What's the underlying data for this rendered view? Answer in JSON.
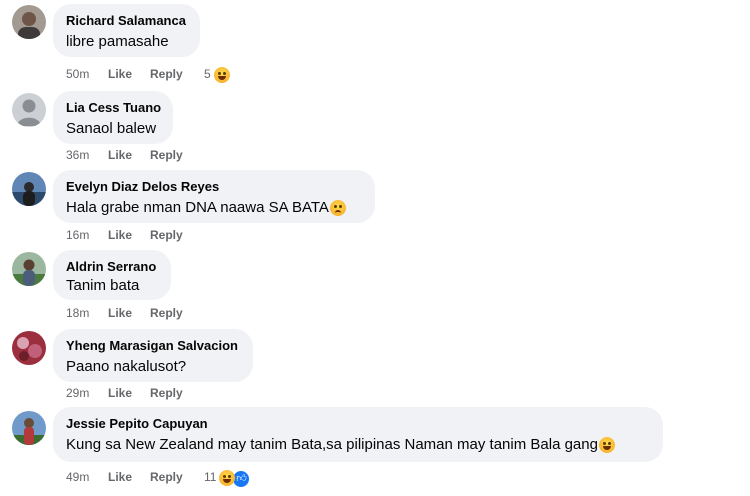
{
  "comments": [
    {
      "name": "Richard Salamanca",
      "text": "libre pamasahe",
      "time": "50m",
      "like": "Like",
      "reply": "Reply",
      "reaction_count": "5",
      "reaction_icon": "laughing-emoji-icon"
    },
    {
      "name": "Lia Cess Tuano",
      "text": "Sanaol balew",
      "time": "36m",
      "like": "Like",
      "reply": "Reply"
    },
    {
      "name": "Evelyn Diaz Delos Reyes",
      "text": "Hala grabe nman DNA naawa SA BATA",
      "time": "16m",
      "like": "Like",
      "reply": "Reply",
      "trailing_icon": "sad-emoji-icon"
    },
    {
      "name": "Aldrin Serrano",
      "text": "Tanim bata",
      "time": "18m",
      "like": "Like",
      "reply": "Reply"
    },
    {
      "name": "Yheng Marasigan Salvacion",
      "text": "Paano nakalusot?",
      "time": "29m",
      "like": "Like",
      "reply": "Reply"
    },
    {
      "name": "Jessie Pepito Capuyan",
      "text": "Kung sa New Zealand may tanim Bata,sa pilipinas Naman may tanim Bala gang",
      "time": "49m",
      "like": "Like",
      "reply": "Reply",
      "reaction_count": "11",
      "reaction_icon": "laughing-emoji-icon",
      "trailing_icon": "rofl-emoji-icon"
    }
  ],
  "colors": {
    "bubble": "#f0f2f5",
    "meta": "#65676b",
    "like_blue": "#1877f2"
  }
}
